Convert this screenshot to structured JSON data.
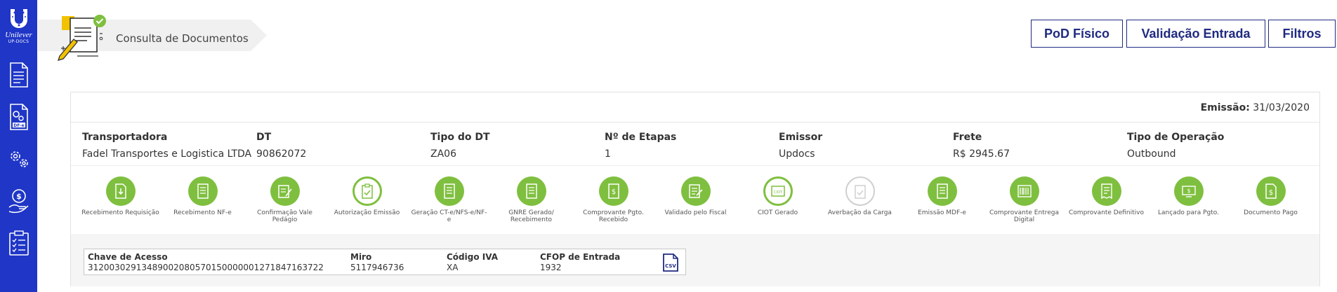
{
  "sidebar": {
    "logo": {
      "brand": "Unilever",
      "sub": "UP-DOCS"
    },
    "items": [
      {
        "name": "documents",
        "icon": "document-icon"
      },
      {
        "name": "df-e",
        "icon": "gear-document-icon",
        "badge": "DF-e"
      },
      {
        "name": "settings",
        "icon": "gears-icon"
      },
      {
        "name": "payments",
        "icon": "hand-money-icon"
      },
      {
        "name": "checklist",
        "icon": "clipboard-check-icon"
      }
    ]
  },
  "header": {
    "breadcrumb": "Consulta de Documentos",
    "buttons": [
      "PoD Físico",
      "Validação Entrada",
      "Filtros"
    ]
  },
  "document": {
    "emissao_label": "Emissão:",
    "emissao_value": "31/03/2020",
    "info": [
      {
        "label": "Transportadora",
        "value": "Fadel Transportes e Logistica LTDA"
      },
      {
        "label": "DT",
        "value": "90862072"
      },
      {
        "label": "Tipo do DT",
        "value": "ZA06"
      },
      {
        "label": "Nº de Etapas",
        "value": "1"
      },
      {
        "label": "Emissor",
        "value": "Updocs"
      },
      {
        "label": "Frete",
        "value": "R$ 2945.67"
      },
      {
        "label": "Tipo de Operação",
        "value": "Outbound"
      }
    ],
    "steps": [
      {
        "label": "Recebimento Requisição",
        "state": "done"
      },
      {
        "label": "Recebimento NF-e",
        "state": "done"
      },
      {
        "label": "Confirmação Vale Pedágio",
        "state": "done"
      },
      {
        "label": "Autorização Emissão",
        "state": "current"
      },
      {
        "label": "Geração CT-e/NFS-e/NF-e",
        "state": "done"
      },
      {
        "label": "GNRE Gerado/ Recebimento",
        "state": "done"
      },
      {
        "label": "Comprovante Pgto. Recebido",
        "state": "done"
      },
      {
        "label": "Validado pelo Fiscal",
        "state": "done"
      },
      {
        "label": "CIOT Gerado",
        "state": "current"
      },
      {
        "label": "Averbação da Carga",
        "state": "pending"
      },
      {
        "label": "Emissão MDF-e",
        "state": "done"
      },
      {
        "label": "Comprovante Entrega Digital",
        "state": "done"
      },
      {
        "label": "Comprovante Definitivo",
        "state": "done"
      },
      {
        "label": "Lançado para Pgto.",
        "state": "done"
      },
      {
        "label": "Documento Pago",
        "state": "done"
      }
    ],
    "keys": {
      "chave_label": "Chave de Acesso",
      "chave_value": "31200302913489002080570150000001271847163722",
      "miro_label": "Miro",
      "miro_value": "5117946736",
      "iva_label": "Código IVA",
      "iva_value": "XA",
      "cfop_label": "CFOP de Entrada",
      "cfop_value": "1932",
      "csv_label": "CSV"
    }
  },
  "colors": {
    "sidebar": "#1f36c7",
    "accent": "#1f2a80",
    "step_green": "#7fbf3f",
    "pending_gray": "#cfcfcf"
  }
}
